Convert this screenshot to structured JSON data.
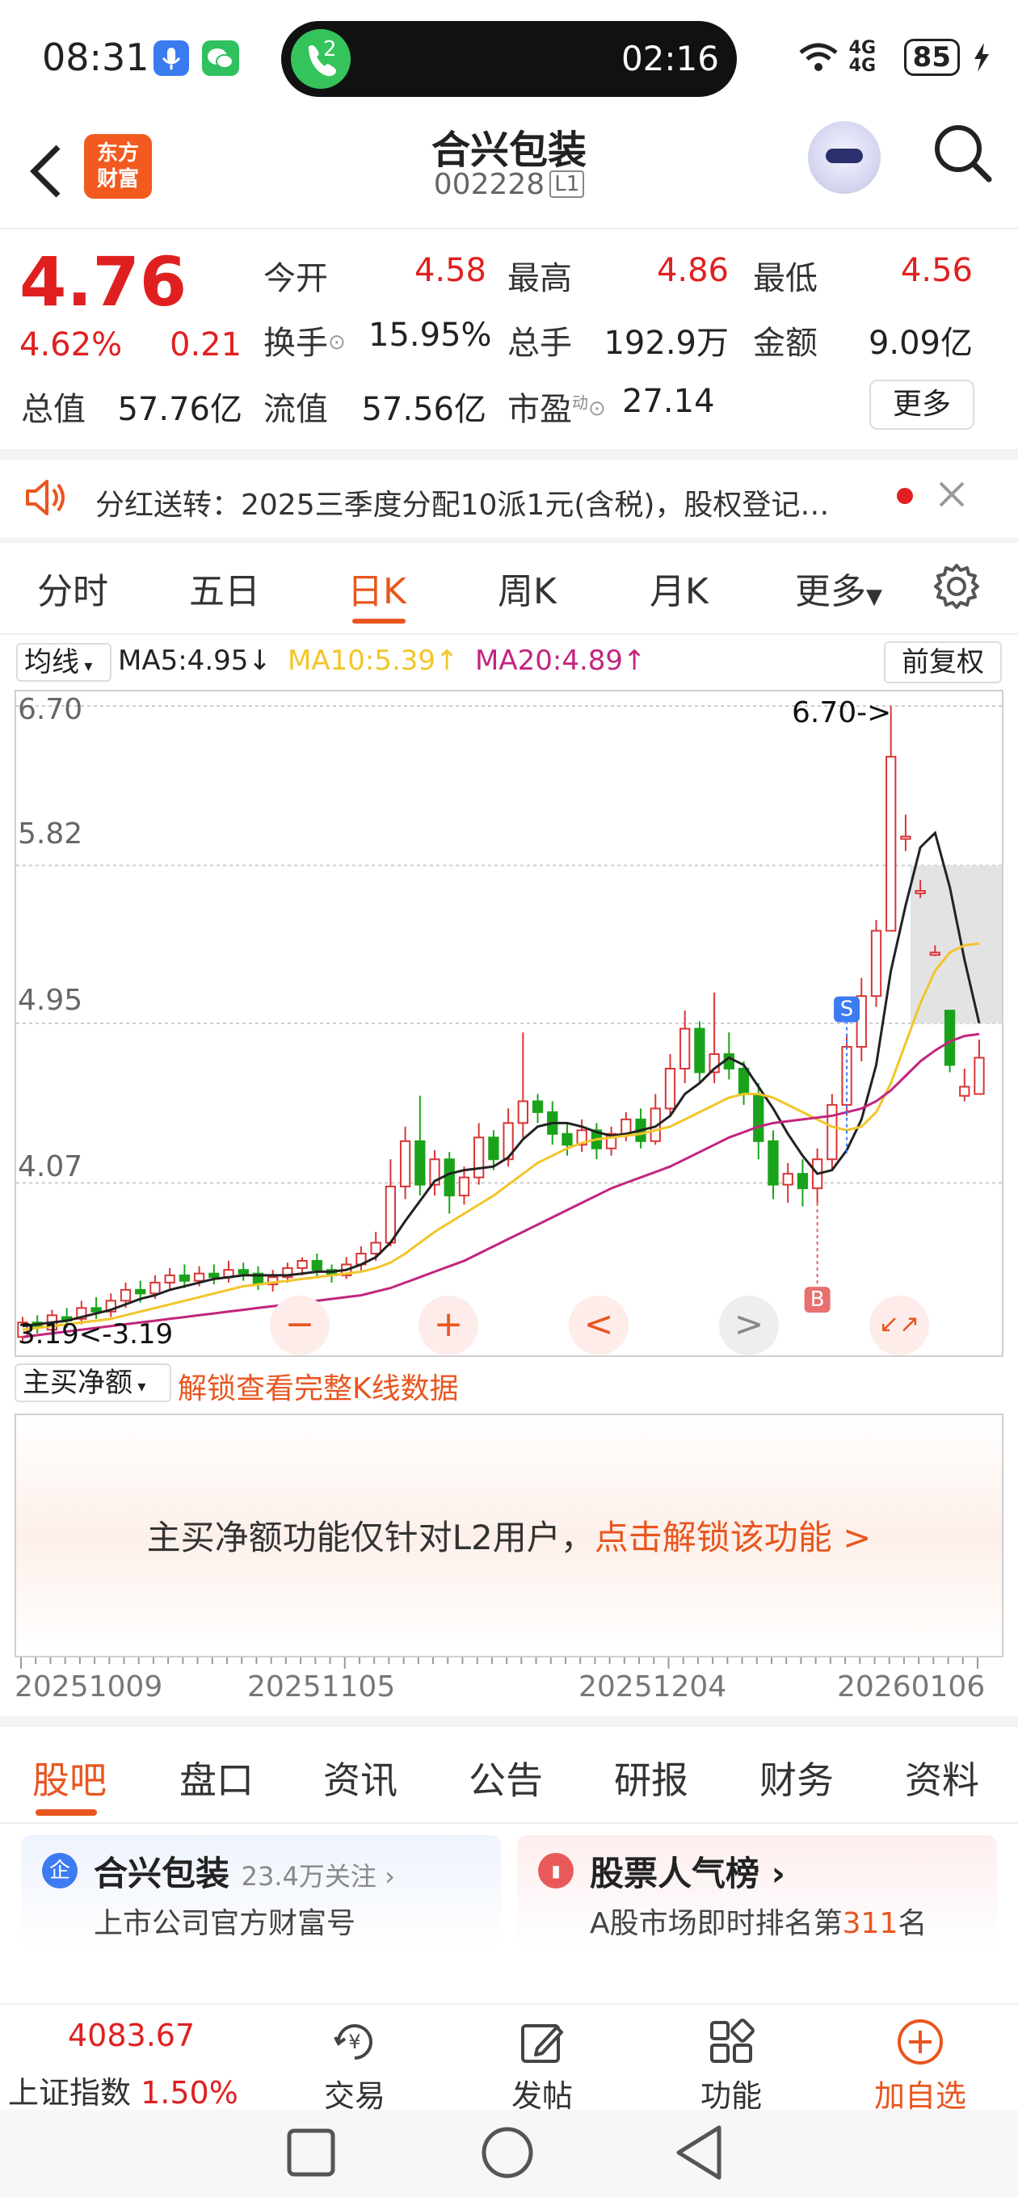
{
  "status_bar": {
    "time": "08:31",
    "call_badge": "2",
    "call_timer": "02:16",
    "network": "4G 4G",
    "battery": "85"
  },
  "header": {
    "logo_text": "东方\n财富",
    "title": "合兴包装",
    "code": "002228",
    "code_badge": "L1"
  },
  "quote": {
    "price": "4.76",
    "change_pct": "4.62%",
    "change": "0.21",
    "fields": {
      "open_label": "今开",
      "open": "4.58",
      "high_label": "最高",
      "high": "4.86",
      "low_label": "最低",
      "low": "4.56",
      "turnover_label": "换手",
      "turnover": "15.95%",
      "volume_label": "总手",
      "volume": "192.9万",
      "amount_label": "金额",
      "amount": "9.09亿",
      "mktcap_label": "总值",
      "mktcap": "57.76亿",
      "float_label": "流值",
      "float": "57.56亿",
      "pe_label": "市盈",
      "pe_sup": "动",
      "pe": "27.14"
    },
    "more_label": "更多"
  },
  "notice": {
    "text": "分红送转：2025三季度分配10派1元(含税)，股权登记…"
  },
  "period_tabs": [
    "分时",
    "五日",
    "日K",
    "周K",
    "月K",
    "更多"
  ],
  "active_period": "日K",
  "ma": {
    "selector": "均线",
    "ma5": "MA5:4.95",
    "ma5_arrow": "↓",
    "ma10": "MA10:5.39",
    "ma10_arrow": "↑",
    "ma20": "MA20:4.89",
    "ma20_arrow": "↑",
    "adjust": "前复权",
    "colors": {
      "ma5": "#222222",
      "ma10": "#f2c52a",
      "ma20": "#c2257f",
      "up": "#d93535",
      "down": "#1aa31a"
    }
  },
  "chart_labels": {
    "y_ticks": [
      "6.70",
      "5.82",
      "4.95",
      "4.07"
    ],
    "high_label": "6.70->",
    "low_label": "3.19<-3.19",
    "sell_marker": "S",
    "buy_marker": "B",
    "controls": [
      "−",
      "+",
      "<",
      ">",
      "↙↗"
    ]
  },
  "chart_data": {
    "type": "candlestick",
    "ylim": [
      3.19,
      6.7
    ],
    "x_start": "20251009",
    "x_end": "20260106",
    "x_ticks": [
      "20251009",
      "20251105",
      "20251204",
      "20260106"
    ],
    "candles": [
      [
        3.22,
        3.3,
        3.19,
        3.33
      ],
      [
        3.3,
        3.28,
        3.24,
        3.34
      ],
      [
        3.26,
        3.34,
        3.23,
        3.37
      ],
      [
        3.33,
        3.31,
        3.27,
        3.38
      ],
      [
        3.32,
        3.38,
        3.29,
        3.42
      ],
      [
        3.38,
        3.36,
        3.32,
        3.44
      ],
      [
        3.36,
        3.42,
        3.33,
        3.46
      ],
      [
        3.42,
        3.48,
        3.38,
        3.52
      ],
      [
        3.48,
        3.46,
        3.41,
        3.53
      ],
      [
        3.46,
        3.52,
        3.43,
        3.56
      ],
      [
        3.52,
        3.56,
        3.48,
        3.6
      ],
      [
        3.56,
        3.53,
        3.49,
        3.62
      ],
      [
        3.53,
        3.57,
        3.5,
        3.61
      ],
      [
        3.57,
        3.55,
        3.51,
        3.62
      ],
      [
        3.55,
        3.59,
        3.52,
        3.64
      ],
      [
        3.59,
        3.57,
        3.53,
        3.63
      ],
      [
        3.57,
        3.51,
        3.48,
        3.61
      ],
      [
        3.51,
        3.55,
        3.47,
        3.59
      ],
      [
        3.55,
        3.6,
        3.52,
        3.63
      ],
      [
        3.6,
        3.64,
        3.56,
        3.66
      ],
      [
        3.64,
        3.59,
        3.55,
        3.68
      ],
      [
        3.59,
        3.56,
        3.52,
        3.62
      ],
      [
        3.56,
        3.62,
        3.54,
        3.66
      ],
      [
        3.62,
        3.68,
        3.58,
        3.72
      ],
      [
        3.68,
        3.74,
        3.64,
        3.8
      ],
      [
        3.74,
        4.05,
        3.72,
        4.2
      ],
      [
        4.05,
        4.3,
        3.98,
        4.38
      ],
      [
        4.3,
        4.06,
        4.0,
        4.55
      ],
      [
        4.06,
        4.2,
        4.0,
        4.25
      ],
      [
        4.2,
        4.0,
        3.9,
        4.24
      ],
      [
        4.0,
        4.1,
        3.95,
        4.16
      ],
      [
        4.1,
        4.32,
        4.06,
        4.4
      ],
      [
        4.32,
        4.2,
        4.14,
        4.36
      ],
      [
        4.2,
        4.4,
        4.16,
        4.48
      ],
      [
        4.4,
        4.52,
        4.32,
        4.9
      ],
      [
        4.52,
        4.46,
        4.4,
        4.56
      ],
      [
        4.46,
        4.34,
        4.28,
        4.52
      ],
      [
        4.34,
        4.28,
        4.22,
        4.4
      ],
      [
        4.28,
        4.36,
        4.24,
        4.42
      ],
      [
        4.36,
        4.26,
        4.2,
        4.4
      ],
      [
        4.26,
        4.34,
        4.22,
        4.38
      ],
      [
        4.34,
        4.42,
        4.3,
        4.46
      ],
      [
        4.42,
        4.3,
        4.26,
        4.48
      ],
      [
        4.3,
        4.48,
        4.28,
        4.56
      ],
      [
        4.48,
        4.7,
        4.44,
        4.78
      ],
      [
        4.7,
        4.92,
        4.62,
        5.02
      ],
      [
        4.92,
        4.68,
        4.62,
        4.96
      ],
      [
        4.68,
        4.78,
        4.62,
        5.12
      ],
      [
        4.78,
        4.7,
        4.64,
        4.9
      ],
      [
        4.7,
        4.56,
        4.5,
        4.74
      ],
      [
        4.56,
        4.3,
        4.2,
        4.62
      ],
      [
        4.3,
        4.06,
        3.98,
        4.36
      ],
      [
        4.06,
        4.12,
        3.96,
        4.18
      ],
      [
        4.12,
        4.04,
        3.94,
        4.2
      ],
      [
        4.04,
        4.2,
        3.96,
        4.26
      ],
      [
        4.2,
        4.5,
        4.14,
        4.56
      ],
      [
        4.5,
        4.82,
        4.44,
        4.88
      ],
      [
        4.82,
        5.1,
        4.74,
        5.2
      ],
      [
        5.1,
        5.46,
        5.04,
        5.52
      ],
      [
        5.46,
        6.42,
        5.46,
        6.7
      ],
      [
        5.98,
        5.98,
        5.9,
        6.1
      ],
      [
        5.68,
        5.68,
        5.64,
        5.74
      ],
      [
        5.34,
        5.34,
        5.32,
        5.38
      ],
      [
        5.02,
        4.72,
        4.68,
        5.02
      ],
      [
        4.55,
        4.6,
        4.52,
        4.7
      ],
      [
        4.56,
        4.76,
        4.56,
        4.86
      ]
    ],
    "series": [
      {
        "name": "MA5",
        "values": [
          3.28,
          3.29,
          3.3,
          3.31,
          3.33,
          3.35,
          3.37,
          3.4,
          3.43,
          3.45,
          3.48,
          3.5,
          3.52,
          3.54,
          3.55,
          3.56,
          3.56,
          3.56,
          3.56,
          3.57,
          3.58,
          3.58,
          3.59,
          3.62,
          3.66,
          3.74,
          3.86,
          3.97,
          4.08,
          4.12,
          4.14,
          4.15,
          4.16,
          4.21,
          4.31,
          4.38,
          4.4,
          4.4,
          4.38,
          4.35,
          4.33,
          4.34,
          4.36,
          4.38,
          4.44,
          4.56,
          4.62,
          4.7,
          4.76,
          4.72,
          4.6,
          4.48,
          4.34,
          4.22,
          4.12,
          4.14,
          4.25,
          4.42,
          4.72,
          5.24,
          5.6,
          5.92,
          6.0,
          5.7,
          5.3,
          4.95
        ]
      },
      {
        "name": "MA10",
        "values": [
          3.26,
          3.27,
          3.28,
          3.29,
          3.3,
          3.31,
          3.32,
          3.34,
          3.36,
          3.38,
          3.4,
          3.42,
          3.44,
          3.46,
          3.48,
          3.5,
          3.51,
          3.52,
          3.53,
          3.54,
          3.55,
          3.56,
          3.57,
          3.58,
          3.6,
          3.63,
          3.68,
          3.74,
          3.8,
          3.85,
          3.9,
          3.95,
          4.0,
          4.06,
          4.12,
          4.18,
          4.22,
          4.26,
          4.29,
          4.31,
          4.32,
          4.33,
          4.34,
          4.36,
          4.38,
          4.42,
          4.46,
          4.5,
          4.54,
          4.56,
          4.56,
          4.54,
          4.5,
          4.46,
          4.42,
          4.38,
          4.36,
          4.38,
          4.46,
          4.62,
          4.84,
          5.06,
          5.24,
          5.34,
          5.38,
          5.39
        ]
      },
      {
        "name": "MA20",
        "values": [
          3.22,
          3.23,
          3.24,
          3.25,
          3.26,
          3.27,
          3.28,
          3.29,
          3.3,
          3.31,
          3.32,
          3.33,
          3.34,
          3.35,
          3.36,
          3.37,
          3.38,
          3.39,
          3.4,
          3.41,
          3.42,
          3.43,
          3.44,
          3.45,
          3.47,
          3.49,
          3.52,
          3.55,
          3.58,
          3.61,
          3.64,
          3.68,
          3.72,
          3.76,
          3.8,
          3.84,
          3.88,
          3.92,
          3.96,
          4.0,
          4.04,
          4.07,
          4.1,
          4.13,
          4.16,
          4.2,
          4.24,
          4.28,
          4.32,
          4.35,
          4.38,
          4.4,
          4.41,
          4.42,
          4.43,
          4.44,
          4.46,
          4.48,
          4.52,
          4.58,
          4.66,
          4.74,
          4.8,
          4.85,
          4.88,
          4.89
        ]
      }
    ]
  },
  "sub_indicator": {
    "selector": "主买净额",
    "unlock_link": "解锁查看完整K线数据",
    "message": "主买净额功能仅针对L2用户，",
    "message_link": "点击解锁该功能 >"
  },
  "section_tabs": [
    "股吧",
    "盘口",
    "资讯",
    "公告",
    "研报",
    "财务",
    "资料"
  ],
  "active_section": "股吧",
  "cards": [
    {
      "icon": "企",
      "title": "合兴包装",
      "meta": "23.4万关注 ›",
      "sub": "上市公司官方财富号"
    },
    {
      "icon": "▮",
      "title": "股票人气榜 ›",
      "sub_prefix": "A股市场即时排名第",
      "rank": "311",
      "sub_suffix": "名"
    }
  ],
  "bottom_bar": {
    "index_value": "4083.67",
    "index_name": "上证指数",
    "index_pct": "1.50%",
    "items": [
      "交易",
      "发帖",
      "功能",
      "加自选"
    ]
  }
}
